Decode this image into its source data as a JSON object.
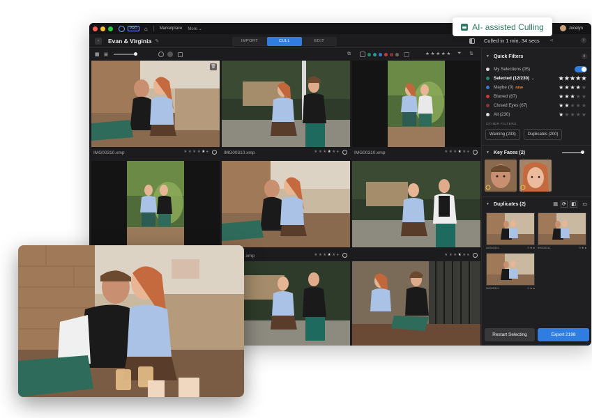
{
  "titlebar": {
    "pro_badge": "PRO",
    "menu_marketplace": "Marketplace",
    "menu_more": "More",
    "user_name": "Jocelyn"
  },
  "header": {
    "project_title": "Evan & Virginia",
    "tabs": [
      {
        "label": "IMPORT"
      },
      {
        "label": "CULL"
      },
      {
        "label": "EDIT"
      }
    ],
    "culled_text": "Culled in 1 min, 34 secs"
  },
  "ai_badge": {
    "label": "AI- assisted Culling"
  },
  "colors": {
    "accent": "#2f7de1",
    "green": "#1e8c6b",
    "blue": "#3a78d4",
    "red": "#c93a3a",
    "maroon": "#8a3535",
    "ai_text": "#2b7a5f"
  },
  "photos": [
    {
      "filename": "IMG00310.xmp",
      "scene": "sitting"
    },
    {
      "filename": "IMG00310.xmp",
      "scene": "standing"
    },
    {
      "filename": "IMG00310.xmp",
      "scene": "blurred"
    },
    {
      "filename": "",
      "scene": "blurred"
    },
    {
      "filename": "",
      "scene": "sitting"
    },
    {
      "filename": "",
      "scene": "standing"
    },
    {
      "filename": ".xmp",
      "scene": "sitting"
    },
    {
      "filename": "",
      "scene": "standing"
    },
    {
      "filename": "",
      "scene": "fence"
    }
  ],
  "sidebar": {
    "quick_filters_title": "Quick Filters",
    "filters": [
      {
        "label": "My Selections (05)",
        "dot": "#dddddd",
        "stars": 0,
        "toggle": true,
        "bold": false
      },
      {
        "label": "Selected (12/230)",
        "dot": "#1e8c6b",
        "stars": 5,
        "toggle": false,
        "bold": true
      },
      {
        "label": "Maybe (0)",
        "dot": "#3a78d4",
        "stars": 4,
        "toggle": false,
        "bold": false,
        "badge": "NEW"
      },
      {
        "label": "Blurred (87)",
        "dot": "#c93a3a",
        "stars": 3,
        "toggle": false,
        "bold": false
      },
      {
        "label": "Closed Eyes (67)",
        "dot": "#8a3535",
        "stars": 2,
        "toggle": false,
        "bold": false
      },
      {
        "label": "All (230)",
        "dot": "#dddddd",
        "stars": 1,
        "toggle": false,
        "bold": false
      }
    ],
    "other_filters_label": "OTHER FILTERS",
    "other_filters": [
      {
        "label": "Warning (233)"
      },
      {
        "label": "Duplicates (200)"
      }
    ],
    "key_faces_title": "Key Faces (2)",
    "duplicates_title": "Duplicates (2)",
    "duplicate_items": [
      {
        "label": "IMG00310"
      },
      {
        "label": "IMG00311"
      },
      {
        "label": "IMG00310"
      }
    ],
    "restart_label": "Restart Selecting",
    "export_label": "Export 2198"
  }
}
